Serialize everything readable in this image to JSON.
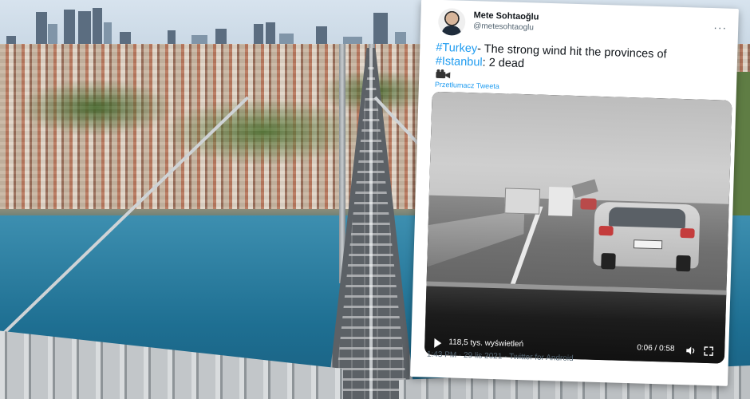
{
  "tweet": {
    "display_name": "Mete Sohtaoğlu",
    "handle": "@metesohtaoglu",
    "more_icon": "more-dots-icon",
    "text_hash1": "#Turkey",
    "text_part1": "- The strong wind hit the provinces of",
    "text_hash2": "#Istanbul",
    "text_part2": ": 2 dead",
    "camera_icon": "video-camera-icon",
    "translate_label": "Przetłumacz Tweeta",
    "video": {
      "views": "118,5 tys. wyświetleń",
      "time": "0:06 / 0:58",
      "play_icon": "play-icon",
      "volume_icon": "volume-icon",
      "fullscreen_icon": "fullscreen-icon"
    },
    "meta": "1:43 PM · 29 lis 2021 · Twitter for Android"
  },
  "colors": {
    "link": "#1d9bf0",
    "text": "#0f1419",
    "muted": "#536471"
  }
}
